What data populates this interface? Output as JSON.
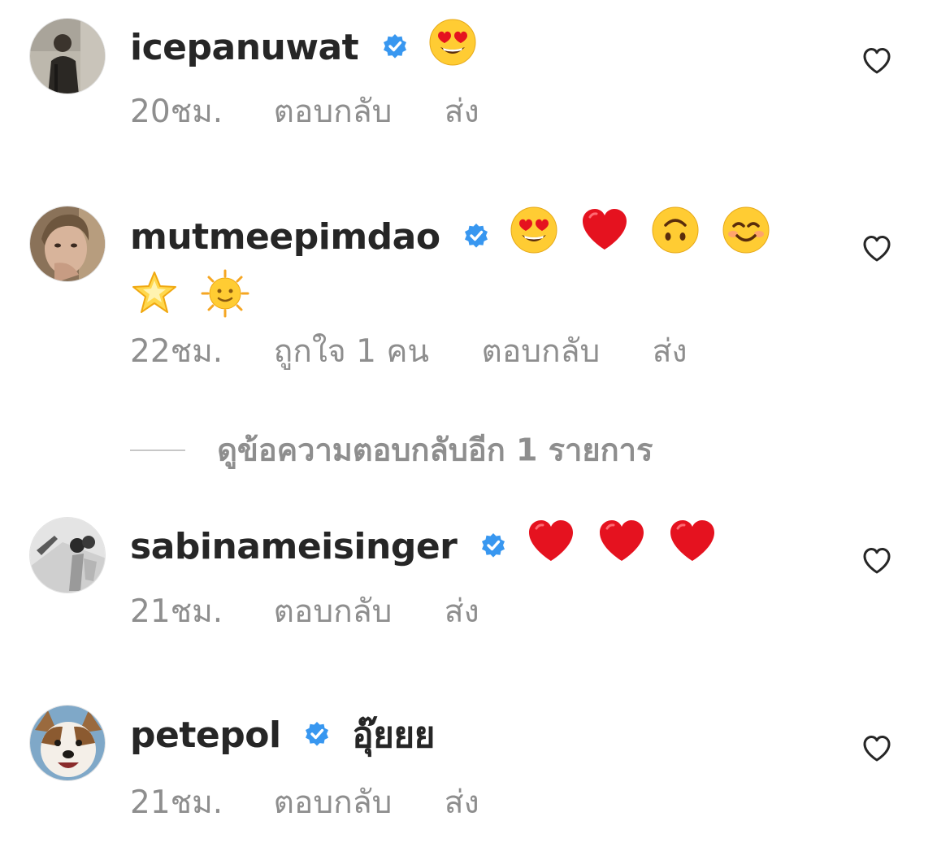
{
  "comments": [
    {
      "username": "icepanuwat",
      "verified": true,
      "text": "",
      "emojis": [
        "heart-eyes"
      ],
      "time": "20ชม.",
      "likes": "",
      "reply_label": "ตอบกลับ",
      "send_label": "ส่ง"
    },
    {
      "username": "mutmeepimdao",
      "verified": true,
      "text": "",
      "emojis": [
        "heart-eyes",
        "red-heart",
        "upside-down-face",
        "smiling-face",
        "glowing-star",
        "sun-with-face"
      ],
      "time": "22ชม.",
      "likes": "ถูกใจ 1 คน",
      "reply_label": "ตอบกลับ",
      "send_label": "ส่ง"
    },
    {
      "username": "sabinameisinger",
      "verified": true,
      "text": "",
      "emojis": [
        "red-heart",
        "red-heart",
        "red-heart"
      ],
      "time": "21ชม.",
      "likes": "",
      "reply_label": "ตอบกลับ",
      "send_label": "ส่ง"
    },
    {
      "username": "petepol",
      "verified": true,
      "text": "อุ๊ยยย",
      "emojis": [],
      "time": "21ชม.",
      "likes": "",
      "reply_label": "ตอบกลับ",
      "send_label": "ส่ง"
    }
  ],
  "view_replies_label": "ดูข้อความตอบกลับอีก 1 รายการ",
  "colors": {
    "text": "#262626",
    "meta": "#8e8e8e",
    "verified": "#3897f0",
    "heart_red": "#e5121f",
    "emoji_yellow": "#ffcc33"
  }
}
